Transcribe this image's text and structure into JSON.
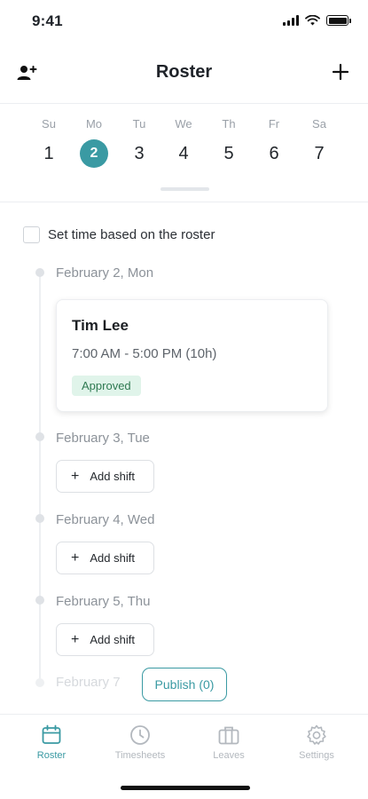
{
  "status_bar": {
    "time": "9:41"
  },
  "header": {
    "title": "Roster",
    "left_icon": "add-user-icon",
    "right_icon": "plus-icon"
  },
  "week": [
    {
      "dow": "Su",
      "num": "1",
      "selected": false
    },
    {
      "dow": "Mo",
      "num": "2",
      "selected": true
    },
    {
      "dow": "Tu",
      "num": "3",
      "selected": false
    },
    {
      "dow": "We",
      "num": "4",
      "selected": false
    },
    {
      "dow": "Th",
      "num": "5",
      "selected": false
    },
    {
      "dow": "Fr",
      "num": "6",
      "selected": false
    },
    {
      "dow": "Sa",
      "num": "7",
      "selected": false
    }
  ],
  "roster_option": {
    "label": "Set time based on the roster",
    "checked": false
  },
  "days": [
    {
      "date": "February 2, Mon"
    },
    {
      "date": "February 3, Tue"
    },
    {
      "date": "February 4, Wed"
    },
    {
      "date": "February 5, Thu"
    },
    {
      "date": "February 7"
    }
  ],
  "shift": {
    "name": "Tim Lee",
    "hours": "7:00 AM - 5:00 PM (10h)",
    "status": "Approved"
  },
  "add_shift_label": "Add shift",
  "publish_label": "Publish (0)",
  "tabs": [
    {
      "label": "Roster",
      "icon": "calendar-icon",
      "active": true
    },
    {
      "label": "Timesheets",
      "icon": "clock-icon",
      "active": false
    },
    {
      "label": "Leaves",
      "icon": "briefcase-icon",
      "active": false
    },
    {
      "label": "Settings",
      "icon": "gear-icon",
      "active": false
    }
  ],
  "colors": {
    "accent": "#3a9aa3",
    "approved_bg": "#e0f4ea",
    "approved_text": "#2f7a52",
    "muted": "#9aa0a8"
  }
}
